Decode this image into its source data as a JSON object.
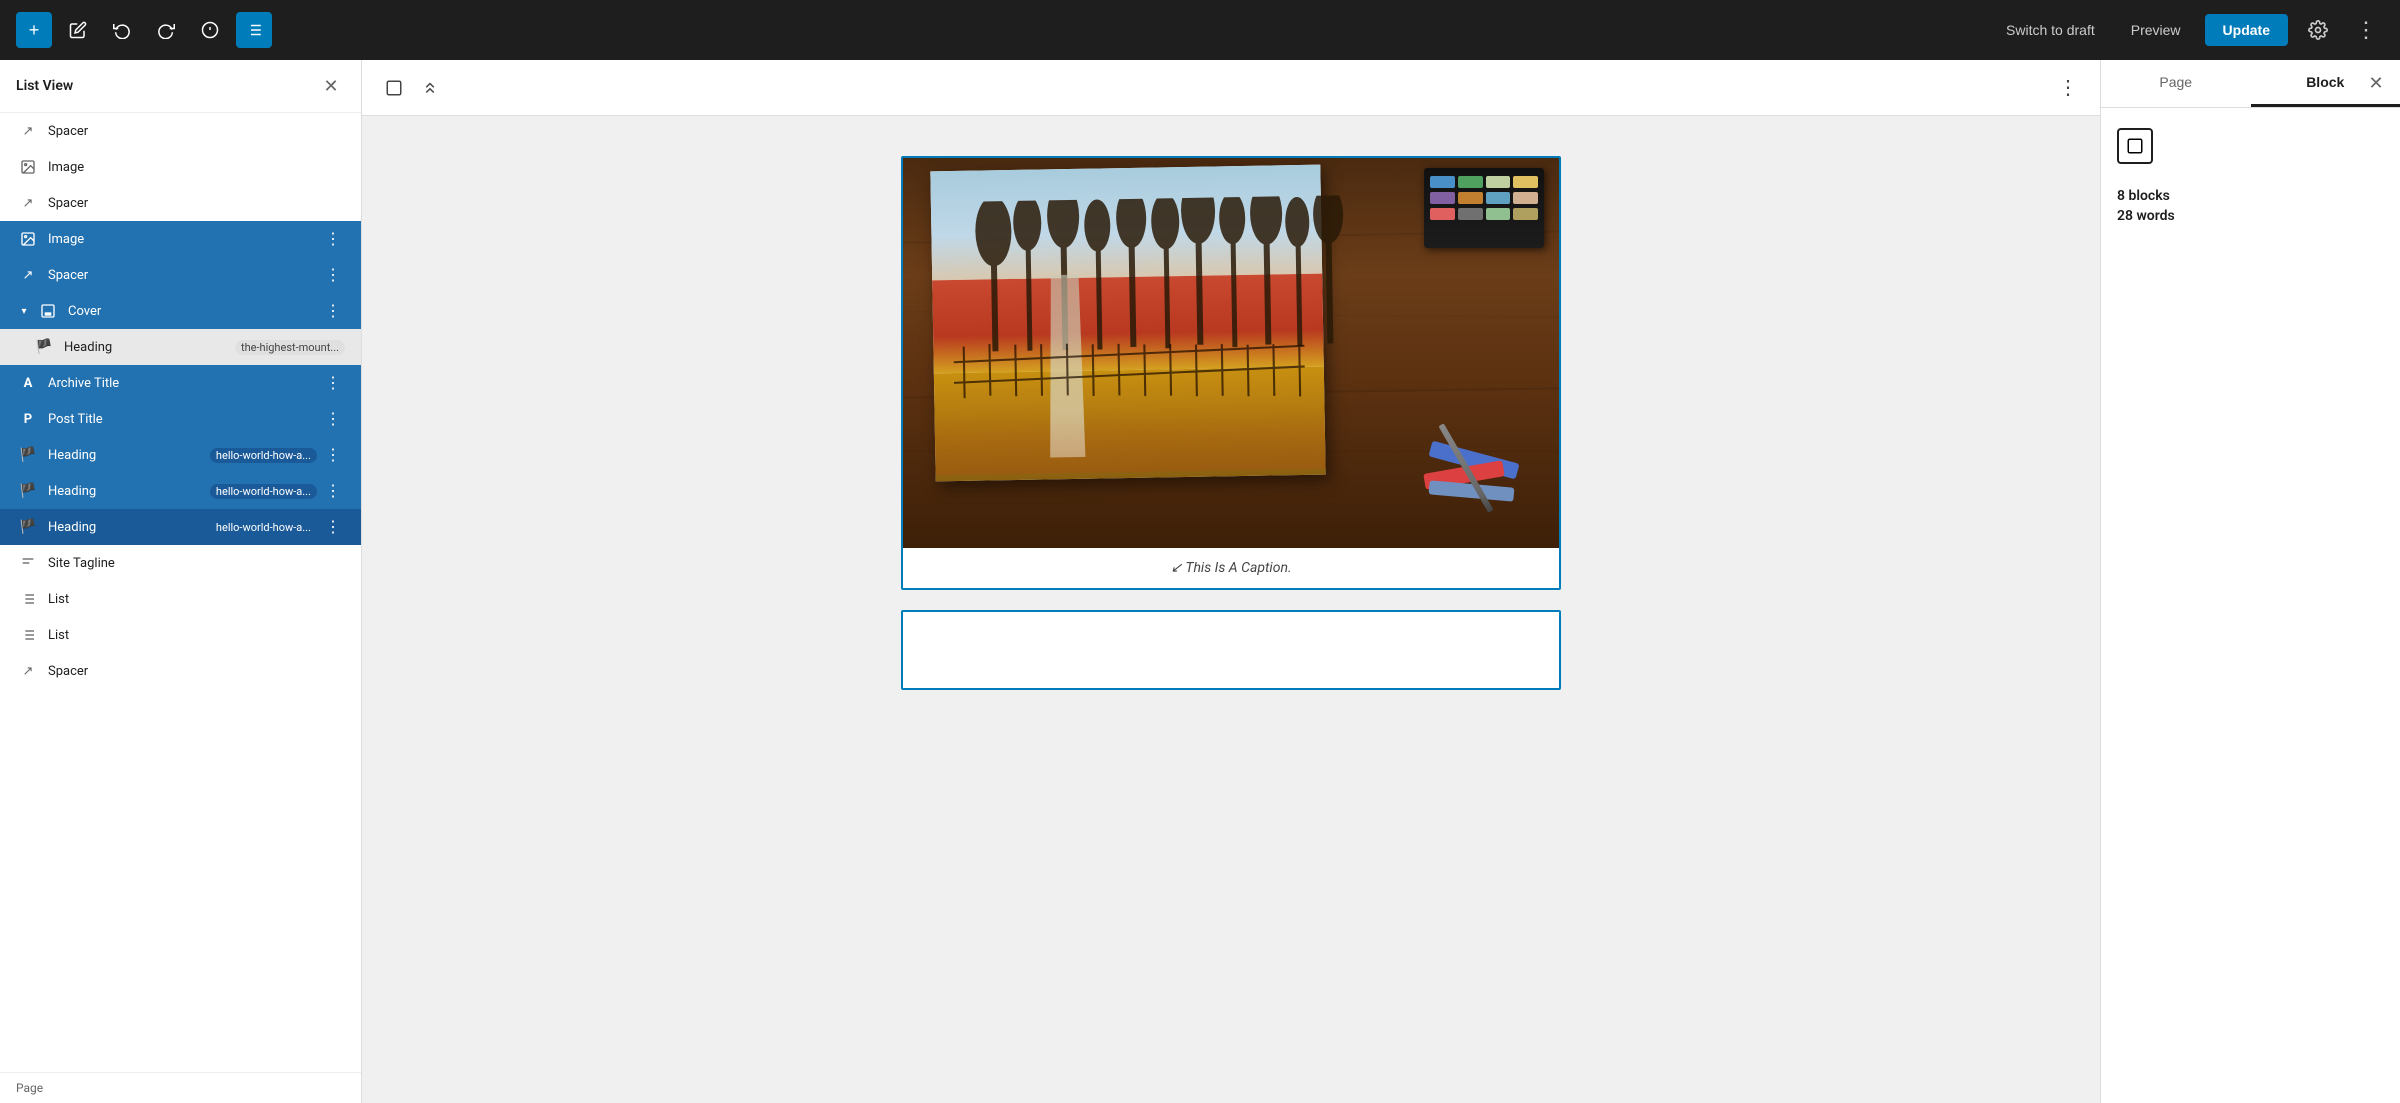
{
  "topbar": {
    "add_label": "+",
    "title": "",
    "switch_draft_label": "Switch to draft",
    "preview_label": "Preview",
    "update_label": "Update",
    "undo_icon": "↩",
    "redo_icon": "↪",
    "info_icon": "ℹ",
    "list_view_icon": "☰",
    "pencil_icon": "✎",
    "settings_icon": "⚙",
    "more_icon": "⋮"
  },
  "sidebar": {
    "title": "List View",
    "close_icon": "✕",
    "items": [
      {
        "id": "spacer-1",
        "label": "Spacer",
        "icon": "↗",
        "type": "spacer",
        "indent": 0,
        "selected": false,
        "has_more": false,
        "tag": ""
      },
      {
        "id": "image-1",
        "label": "Image",
        "icon": "⬜",
        "type": "image",
        "indent": 0,
        "selected": false,
        "has_more": false,
        "tag": ""
      },
      {
        "id": "spacer-2",
        "label": "Spacer",
        "icon": "↗",
        "type": "spacer",
        "indent": 0,
        "selected": false,
        "has_more": false,
        "tag": ""
      },
      {
        "id": "image-2",
        "label": "Image",
        "icon": "⬜",
        "type": "image",
        "indent": 0,
        "selected": true,
        "has_more": true,
        "tag": ""
      },
      {
        "id": "spacer-3",
        "label": "Spacer",
        "icon": "↗",
        "type": "spacer",
        "indent": 0,
        "selected": true,
        "has_more": true,
        "tag": ""
      },
      {
        "id": "cover-1",
        "label": "Cover",
        "icon": "⬜",
        "type": "cover",
        "indent": 0,
        "selected": true,
        "has_more": true,
        "expandable": true,
        "tag": ""
      },
      {
        "id": "heading-in-cover",
        "label": "Heading",
        "icon": "🚩",
        "type": "heading",
        "indent": 1,
        "selected": false,
        "has_more": false,
        "tag": "the-highest-mount..."
      },
      {
        "id": "archive-title",
        "label": "Archive Title",
        "icon": "A",
        "type": "archive-title",
        "indent": 0,
        "selected": true,
        "has_more": true,
        "tag": ""
      },
      {
        "id": "post-title",
        "label": "Post Title",
        "icon": "P",
        "type": "post-title",
        "indent": 0,
        "selected": true,
        "has_more": true,
        "tag": ""
      },
      {
        "id": "heading-2",
        "label": "Heading",
        "icon": "🚩",
        "type": "heading",
        "indent": 0,
        "selected": true,
        "has_more": true,
        "tag": "hello-world-how-a..."
      },
      {
        "id": "heading-3",
        "label": "Heading",
        "icon": "🚩",
        "type": "heading",
        "indent": 0,
        "selected": true,
        "has_more": true,
        "tag": "hello-world-how-a..."
      },
      {
        "id": "heading-4",
        "label": "Heading",
        "icon": "🚩",
        "type": "heading",
        "indent": 0,
        "selected": true,
        "has_more": true,
        "tag": "hello-world-how-a..."
      },
      {
        "id": "site-tagline",
        "label": "Site Tagline",
        "icon": "≡",
        "type": "site-tagline",
        "indent": 0,
        "selected": false,
        "has_more": false,
        "tag": ""
      },
      {
        "id": "list-1",
        "label": "List",
        "icon": "≡",
        "type": "list",
        "indent": 0,
        "selected": false,
        "has_more": false,
        "tag": ""
      },
      {
        "id": "list-2",
        "label": "List",
        "icon": "≡",
        "type": "list",
        "indent": 0,
        "selected": false,
        "has_more": false,
        "tag": ""
      },
      {
        "id": "spacer-4",
        "label": "Spacer",
        "icon": "↗",
        "type": "spacer",
        "indent": 0,
        "selected": false,
        "has_more": false,
        "tag": ""
      }
    ],
    "footer_label": "Page"
  },
  "editor_toolbar": {
    "view_icon": "⬜",
    "arrows_icon": "⇅",
    "more_icon": "⋮"
  },
  "editor": {
    "caption": "↙ This Is A Caption."
  },
  "right_panel": {
    "tabs": [
      {
        "id": "page",
        "label": "Page",
        "active": false
      },
      {
        "id": "block",
        "label": "Block",
        "active": true
      }
    ],
    "close_icon": "✕",
    "block_count_label": "8 blocks",
    "word_count_label": "28 words"
  }
}
